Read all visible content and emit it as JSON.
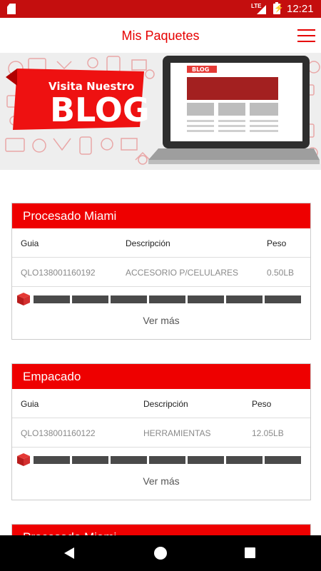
{
  "status_bar": {
    "network": "LTE",
    "time": "12:21"
  },
  "app_bar": {
    "title": "Mis Paquetes"
  },
  "banner": {
    "line1": "Visita Nuestro",
    "line2": "BLOG",
    "tag": "BLOG"
  },
  "cards": [
    {
      "status": "Procesado Miami",
      "headers": {
        "guia": "Guia",
        "descripcion": "Descripción",
        "peso": "Peso"
      },
      "row": {
        "guia": "QLO138001160192",
        "descripcion": "ACCESORIO P/CELULARES",
        "peso": "0.50LB"
      },
      "ver_mas": "Ver más"
    },
    {
      "status": "Empacado",
      "headers": {
        "guia": "Guia",
        "descripcion": "Descripción",
        "peso": "Peso"
      },
      "row": {
        "guia": "QLO138001160122",
        "descripcion": "HERRAMIENTAS",
        "peso": "12.05LB"
      },
      "ver_mas": "Ver más"
    },
    {
      "status": "Procesado Miami"
    }
  ],
  "colors": {
    "primary": "#ee0000",
    "status_bar": "#c40e0e",
    "progress": "#4a4a4a"
  }
}
